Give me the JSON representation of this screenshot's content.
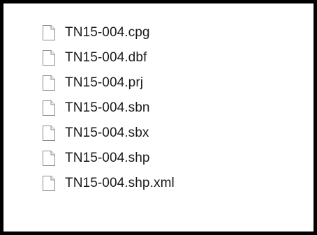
{
  "files": [
    {
      "name": "TN15-004.cpg",
      "icon": "generic-file-icon"
    },
    {
      "name": "TN15-004.dbf",
      "icon": "generic-file-icon"
    },
    {
      "name": "TN15-004.prj",
      "icon": "generic-file-icon"
    },
    {
      "name": "TN15-004.sbn",
      "icon": "generic-file-icon"
    },
    {
      "name": "TN15-004.sbx",
      "icon": "generic-file-icon"
    },
    {
      "name": "TN15-004.shp",
      "icon": "generic-file-icon"
    },
    {
      "name": "TN15-004.shp.xml",
      "icon": "generic-file-icon"
    }
  ],
  "colors": {
    "border": "#000000",
    "background": "#ffffff",
    "text": "#1a1a1a",
    "icon_stroke": "#8c8c8c",
    "icon_fill": "#ffffff"
  }
}
